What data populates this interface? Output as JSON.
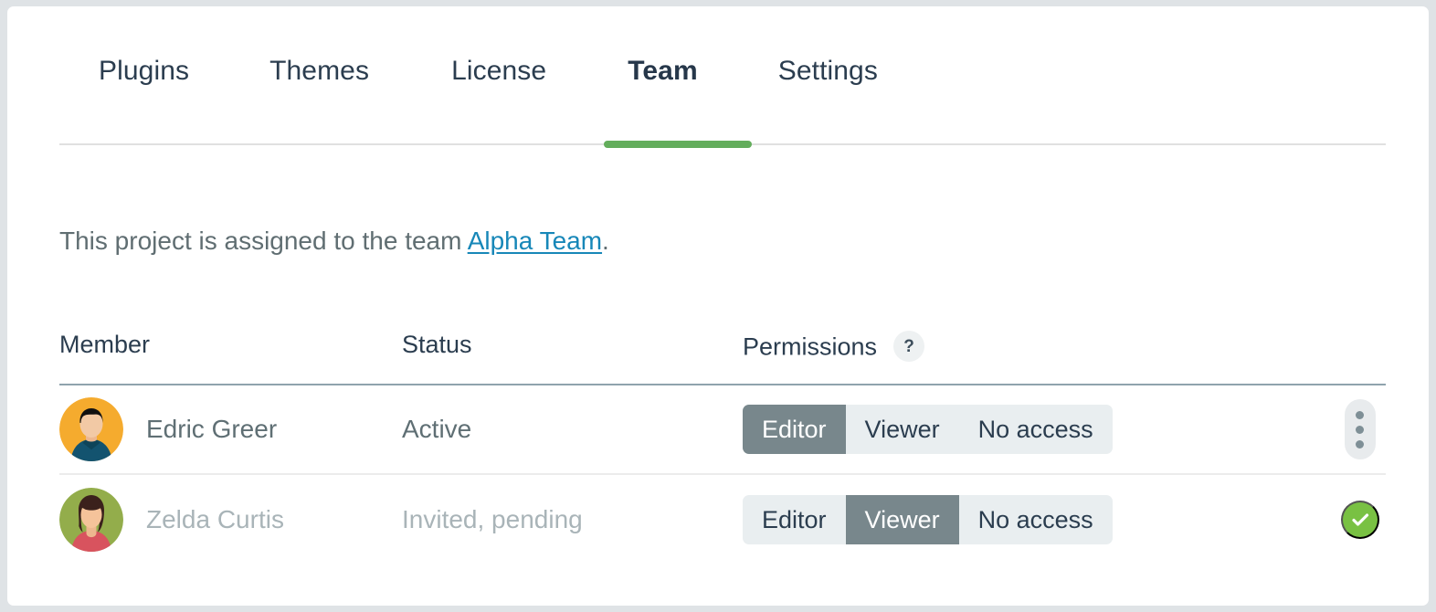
{
  "tabs": [
    {
      "label": "Plugins",
      "active": false
    },
    {
      "label": "Themes",
      "active": false
    },
    {
      "label": "License",
      "active": false
    },
    {
      "label": "Team",
      "active": true
    },
    {
      "label": "Settings",
      "active": false
    }
  ],
  "intro": {
    "prefix": "This project is assigned to the team ",
    "link_text": "Alpha Team",
    "suffix": "."
  },
  "table": {
    "headers": {
      "member": "Member",
      "status": "Status",
      "permissions": "Permissions",
      "help_icon": "?"
    },
    "rows": [
      {
        "name": "Edric Greer",
        "status": "Active",
        "pending": false,
        "permissions": [
          "Editor",
          "Viewer",
          "No access"
        ],
        "selected_permission": "Editor",
        "action": "kebab-menu"
      },
      {
        "name": "Zelda Curtis",
        "status": "Invited, pending",
        "pending": true,
        "permissions": [
          "Editor",
          "Viewer",
          "No access"
        ],
        "selected_permission": "Viewer",
        "action": "check-confirm"
      }
    ]
  },
  "colors": {
    "page_background": "#dfe3e6",
    "card_background": "#ffffff",
    "tab_text": "#2b3d4f",
    "active_tab_indicator": "#63ad5c",
    "link": "#1787b8",
    "body_text": "#5f6f74",
    "muted_text": "#a9b4b8",
    "segmented_background": "#e9eef0",
    "segmented_selected": "#78878c",
    "check_green": "#79c143",
    "header_rule": "#8fa3ad",
    "row_rule": "#ececec"
  },
  "avatars": {
    "edric": {
      "background": "#f5ab2e",
      "hair": "#111111",
      "skin": "#f2c9a5",
      "shirt": "#13536f"
    },
    "zelda": {
      "background": "#93ad4b",
      "hair": "#3b211c",
      "skin": "#f5c39a",
      "shirt": "#d8535e"
    }
  }
}
